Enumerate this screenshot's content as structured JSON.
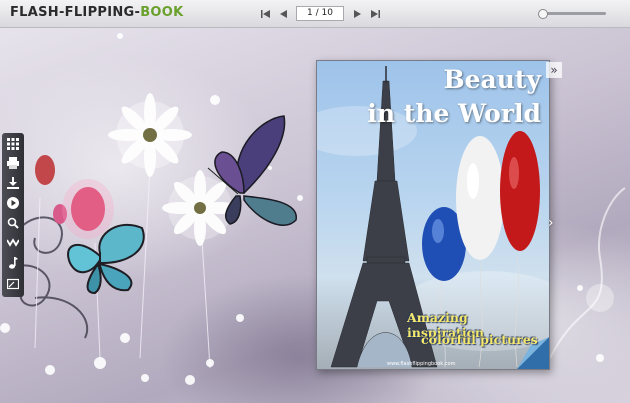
{
  "header": {
    "logo_part1": "FLASH-FLIPPING-",
    "logo_part2": "BOOK",
    "page_indicator": "1 / 10"
  },
  "nav": {
    "first_icon": "first-page-icon",
    "prev_icon": "prev-page-icon",
    "next_icon": "next-page-icon",
    "last_icon": "last-page-icon"
  },
  "zoom": {
    "level": 0
  },
  "toolbar": {
    "items": [
      "thumbnails-icon",
      "print-icon",
      "download-icon",
      "autoplay-icon",
      "search-icon",
      "share-icon",
      "music-icon",
      "fullscreen-icon"
    ]
  },
  "book": {
    "title_line1": "Beauty",
    "title_line2": "in the World",
    "subtitle_line1": "Amazing inspiration",
    "subtitle_line2": "colorful pictures",
    "footer_text": "www.flashflippingbook.com"
  },
  "colors": {
    "accent_green": "#6aa02c",
    "balloon_blue": "#1f4fb5",
    "balloon_white": "#f2f2f2",
    "balloon_red": "#c3191a"
  }
}
